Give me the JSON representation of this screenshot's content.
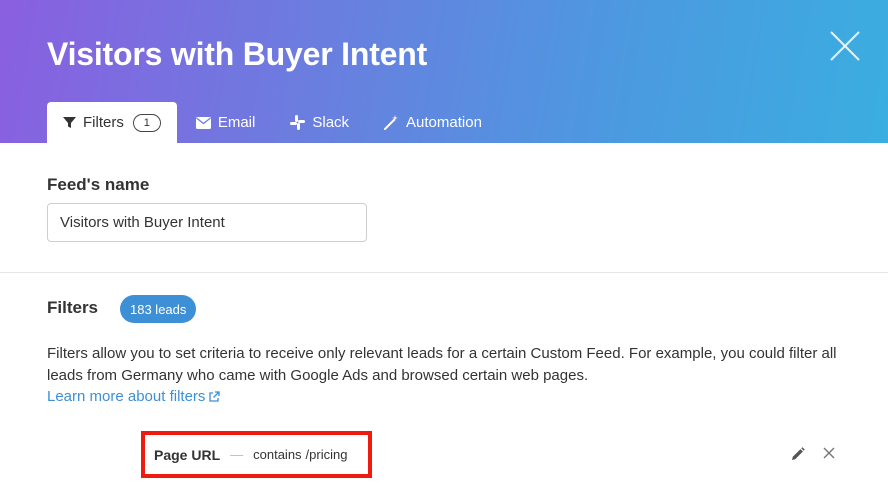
{
  "header": {
    "title": "Visitors with Buyer Intent",
    "gradient_colors": [
      "#8a5fe0",
      "#4b9ae0",
      "#3aaee0"
    ],
    "close_icon": "close-icon"
  },
  "tabs": [
    {
      "label": "Filters",
      "icon": "funnel-icon",
      "count": "1",
      "active": true
    },
    {
      "label": "Email",
      "icon": "envelope-icon",
      "active": false
    },
    {
      "label": "Slack",
      "icon": "slack-icon",
      "active": false
    },
    {
      "label": "Automation",
      "icon": "magic-wand-icon",
      "active": false
    }
  ],
  "feed": {
    "label": "Feed's name",
    "value": "Visitors with Buyer Intent"
  },
  "filters": {
    "title": "Filters",
    "leads_badge": "183 leads",
    "description": "Filters allow you to set criteria to receive only relevant leads for a certain Custom Feed. For example, you could filter all leads from Germany who came with Google Ads and browsed certain web pages.",
    "learn_more": "Learn more about filters",
    "rules": [
      {
        "field": "Page URL",
        "separator": "—",
        "operator": "contains",
        "value": "/pricing"
      }
    ],
    "highlight_color": "#f01b0f",
    "link_color": "#3d8fd6"
  }
}
